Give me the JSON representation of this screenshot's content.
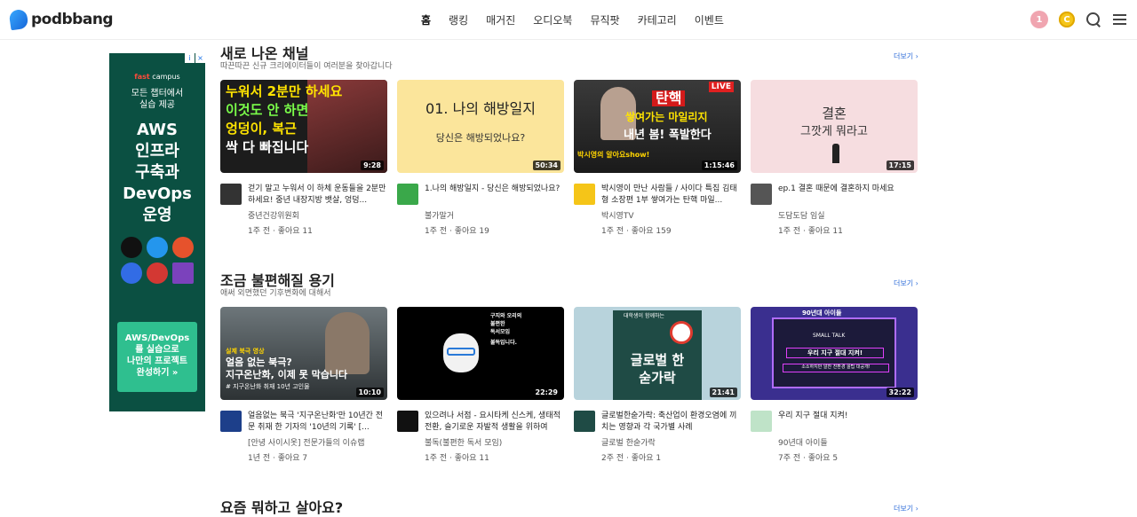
{
  "header": {
    "logo_text": "podbbang",
    "nav": [
      "홈",
      "랭킹",
      "매거진",
      "오디오북",
      "뮤직팟",
      "카테고리",
      "이벤트"
    ],
    "notification_count": "1",
    "coin_label": "C"
  },
  "ad": {
    "brand_prefix": "fast",
    "brand_name": "campus",
    "subtitle_line1": "모든 챕터에서",
    "subtitle_line2": "실습 제공",
    "title_lines": [
      "AWS",
      "인프라",
      "구축과",
      "DevOps",
      "운영"
    ],
    "cta_lines": [
      "AWS/DevOps",
      "를 실습으로",
      "나만의 프로젝트",
      "완성하기 »"
    ],
    "info_labels": [
      "i",
      "×"
    ]
  },
  "sections": [
    {
      "title": "새로 나온 채널",
      "subtitle": "따끈따끈 신규 크리에이터들이 여러분을 찾아갑니다",
      "more": "더보기",
      "cards": [
        {
          "thumb_text": [
            "누워서 2분만 하세요",
            "이것도 안 하면",
            "엉덩이, 복근",
            "싹 다 빠집니다"
          ],
          "duration": "9:28",
          "title": "걷기 말고 누워서 이 하체 운동들을 2분만 하세요! 중년 내장지방 뱃살, 엉덩...",
          "channel": "중년건강위원회",
          "stats": "1주 전 · 좋아요 11",
          "colors": {
            "thumb": "#1c1c1c",
            "avatar": "#333333"
          }
        },
        {
          "thumb_text": [
            "01. 나의 해방일지",
            "당신은 해방되었나요?"
          ],
          "duration": "50:34",
          "title": "1.나의 해방일지 - 당신은 해방되었나요?",
          "channel": "불가말거",
          "stats": "1주 전 · 좋아요 19",
          "colors": {
            "thumb": "#fbe59b",
            "avatar": "#3aa84a"
          }
        },
        {
          "thumb_text": [
            "탄핵",
            "쌓여가는 마일리지",
            "내년 봄! 폭발한다",
            "LIVE",
            "박시영의 알아요show!"
          ],
          "duration": "1:15:46",
          "title": "박시영이 만난 사람들 / 사이다 특집 김태형 소장편 1부 쌓여가는 탄핵 마일...",
          "channel": "박시영TV",
          "stats": "1주 전 · 좋아요 159",
          "colors": {
            "thumb": "#2a2a2a",
            "avatar": "#f5c518"
          }
        },
        {
          "thumb_text": [
            "결혼",
            "그깟게 뭐라고"
          ],
          "duration": "17:15",
          "title": "ep.1 결혼 때문에 결혼하지 마세요",
          "channel": "도담도담 임실",
          "stats": "1주 전 · 좋아요 11",
          "colors": {
            "thumb": "#f6dde0",
            "avatar": "#555555"
          }
        }
      ]
    },
    {
      "title": "조금 불편해질 용기",
      "subtitle": "애써 외면했던 기후변화에 대해서",
      "more": "더보기",
      "cards": [
        {
          "thumb_text": [
            "실제 북극 영상",
            "얼음 없는 북극?",
            "지구온난화, 이제 못 막습니다",
            "# 지구온난화 취재 10년 고인물"
          ],
          "duration": "10:10",
          "title": "얼음없는 북극 '지구온난화'만 10년간 전문 취재 한 기자의 '10년의 기록' [...",
          "channel": "[안녕 사이시옷] 전문가들의 이슈랩",
          "stats": "1년 전 · 좋아요 7",
          "colors": {
            "thumb": "#4a5054",
            "avatar": "#1d3f8a"
          }
        },
        {
          "thumb_text": [
            "구지와 오리의",
            "불편한",
            "독서모임",
            "불독입니다."
          ],
          "duration": "22:29",
          "title": "있으려나 서점 - 요시타케 신스케, 생태적 전환, 슬기로운 자발적 생활을 위하여",
          "channel": "불독(불편한 독서 모임)",
          "stats": "1주 전 · 좋아요 11",
          "colors": {
            "thumb": "#000000",
            "avatar": "#111111"
          }
        },
        {
          "thumb_text": [
            "대학생이 함께하는",
            "글로벌 한",
            "숟가락"
          ],
          "duration": "21:41",
          "title": "글로벌한숟가락: 축산업이 환경오염에 끼치는 영향과 각 국가별 사례",
          "channel": "글로벌 한숟가락",
          "stats": "2주 전 · 좋아요 1",
          "colors": {
            "thumb": "#b8d3dc",
            "avatar": "#1f4b45"
          }
        },
        {
          "thumb_text": [
            "90년대 아이들",
            "SMALL TALK",
            "우리 지구 절대 지켜!",
            "소소하지만 알찬 친환경 꿀팁 대공개!"
          ],
          "duration": "32:22",
          "title": "우리 지구 절대 지켜!",
          "channel": "90년대 아이들",
          "stats": "7주 전 · 좋아요 5",
          "colors": {
            "thumb": "#3a2f8f",
            "avatar": "#bfe3c8"
          }
        }
      ]
    },
    {
      "title": "요즘 뭐하고 살아요?",
      "more": "더보기"
    }
  ]
}
